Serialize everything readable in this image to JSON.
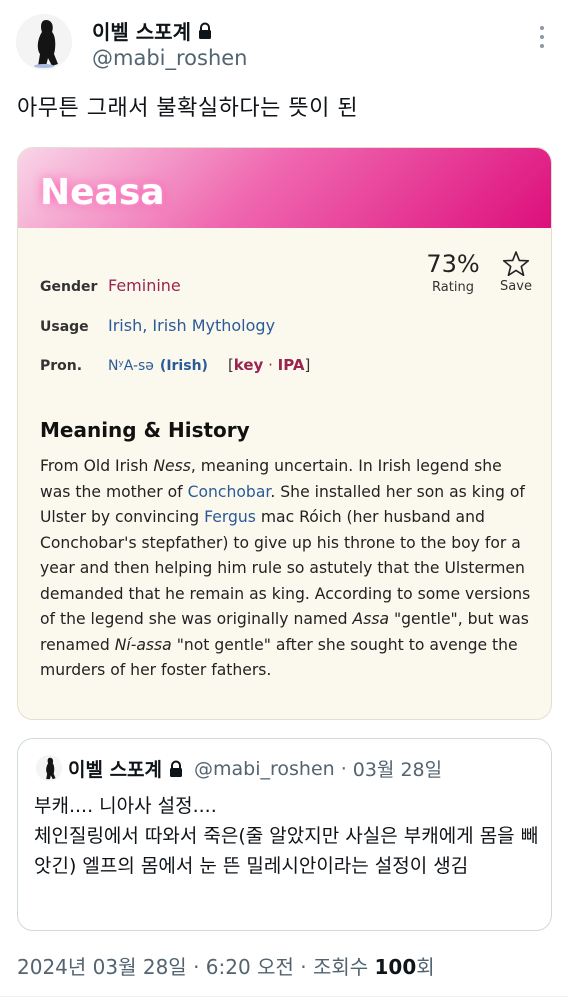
{
  "tweet": {
    "display_name": "이벨 스포계",
    "handle": "@mabi_roshen",
    "text": "아무튼 그래서 불확실하다는 뜻이 된"
  },
  "card": {
    "title": "Neasa",
    "rating": {
      "value": "73%",
      "label": "Rating"
    },
    "save_label": "Save",
    "fields": {
      "gender_label": "Gender",
      "gender_value": "Feminine",
      "usage_label": "Usage",
      "usage_1": "Irish",
      "usage_sep": ", ",
      "usage_2": "Irish Mythology",
      "pron_label": "Pron.",
      "pron_value": "NʸA-sə",
      "pron_lang": "(Irish)",
      "pron_key_open": "[",
      "pron_key": "key",
      "pron_key_dot": " · ",
      "pron_ipa": "IPA",
      "pron_key_close": "]"
    },
    "section_title": "Meaning & History",
    "history": {
      "p1": "From Old Irish ",
      "ness": "Ness",
      "p2": ", meaning uncertain. In Irish legend she was the mother of ",
      "link1": "Conchobar",
      "p3": ". She installed her son as king of Ulster by convincing ",
      "link2": "Fergus",
      "p4": " mac Róich (her husband and Conchobar's stepfather) to give up his throne to the boy for a year and then helping him rule so astutely that the Ulstermen demanded that he remain as king. According to some versions of the legend she was originally named ",
      "assa": "Assa",
      "p5": " \"gentle\", but was renamed ",
      "niassa": "Ní-assa",
      "p6": " \"not gentle\" after she sought to avenge the murders of her foster fathers."
    }
  },
  "quote": {
    "display_name": "이벨 스포계",
    "handle": "@mabi_roshen",
    "dot": "·",
    "date": "03월 28일",
    "line1": "부캐.... 니아사 설정....",
    "line2": "체인질링에서 따와서 죽은(줄 알았지만 사실은 부캐에게 몸을 빼앗긴) 엘프의 몸에서 눈 뜬 밀레시안이라는 설정이 생김"
  },
  "timestamp": {
    "date": "2024년 03월 28일",
    "sep1": " · ",
    "time": "6:20 오전",
    "sep2": " · ",
    "views_label": "조회수 ",
    "views_count": "100",
    "views_suffix": "회"
  },
  "colors": {
    "accent_pink": "#dd0f7c",
    "link_blue": "#2b5a98",
    "gender_red": "#9a2450",
    "card_bg": "#fbf9ee"
  },
  "icons": [
    "lock-icon",
    "more-icon",
    "star-icon",
    "avatar-figure"
  ]
}
